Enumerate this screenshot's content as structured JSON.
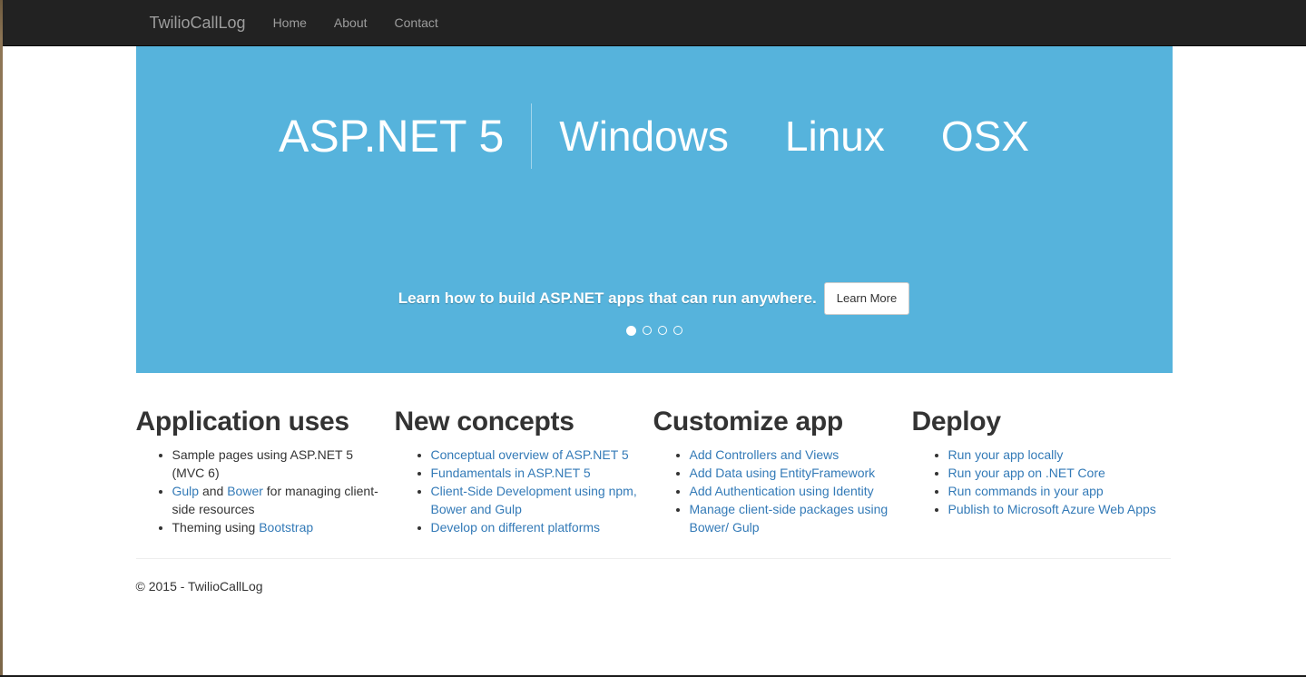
{
  "navbar": {
    "brand": "TwilioCallLog",
    "links": [
      {
        "label": "Home"
      },
      {
        "label": "About"
      },
      {
        "label": "Contact"
      }
    ]
  },
  "carousel": {
    "banner_main": "ASP.NET 5",
    "platforms": [
      "Windows",
      "Linux",
      "OSX"
    ],
    "caption": "Learn how to build ASP.NET apps that can run anywhere.",
    "button_label": "Learn More",
    "indicator_count": 4,
    "active_indicator": 0,
    "background_color": "#56b3dc"
  },
  "features": [
    {
      "title": "Application uses",
      "items": [
        {
          "parts": [
            {
              "text": "Sample pages using ASP.NET 5 (MVC 6)",
              "link": false
            }
          ]
        },
        {
          "parts": [
            {
              "text": "Gulp",
              "link": true
            },
            {
              "text": " and ",
              "link": false
            },
            {
              "text": "Bower",
              "link": true
            },
            {
              "text": " for managing client-side resources",
              "link": false
            }
          ]
        },
        {
          "parts": [
            {
              "text": "Theming using ",
              "link": false
            },
            {
              "text": "Bootstrap",
              "link": true
            }
          ]
        }
      ]
    },
    {
      "title": "New concepts",
      "items": [
        {
          "parts": [
            {
              "text": "Conceptual overview of ASP.NET 5",
              "link": true
            }
          ]
        },
        {
          "parts": [
            {
              "text": "Fundamentals in ASP.NET 5",
              "link": true
            }
          ]
        },
        {
          "parts": [
            {
              "text": "Client-Side Development using npm, Bower and Gulp",
              "link": true
            }
          ]
        },
        {
          "parts": [
            {
              "text": "Develop on different platforms",
              "link": true
            }
          ]
        }
      ]
    },
    {
      "title": "Customize app",
      "items": [
        {
          "parts": [
            {
              "text": "Add Controllers and Views",
              "link": true
            }
          ]
        },
        {
          "parts": [
            {
              "text": "Add Data using EntityFramework",
              "link": true
            }
          ]
        },
        {
          "parts": [
            {
              "text": "Add Authentication using Identity",
              "link": true
            }
          ]
        },
        {
          "parts": [
            {
              "text": "Manage client-side packages using Bower/ Gulp",
              "link": true
            }
          ]
        }
      ]
    },
    {
      "title": "Deploy",
      "items": [
        {
          "parts": [
            {
              "text": "Run your app locally",
              "link": true
            }
          ]
        },
        {
          "parts": [
            {
              "text": "Run your app on .NET Core",
              "link": true
            }
          ]
        },
        {
          "parts": [
            {
              "text": "Run commands in your app",
              "link": true
            }
          ]
        },
        {
          "parts": [
            {
              "text": "Publish to Microsoft Azure Web Apps",
              "link": true
            }
          ]
        }
      ]
    }
  ],
  "footer": {
    "copyright": "© 2015 - TwilioCallLog"
  },
  "colors": {
    "navbar_bg": "#222222",
    "navbar_text": "#9d9d9d",
    "accent_blue": "#56b3dc",
    "link_blue": "#337ab7"
  }
}
